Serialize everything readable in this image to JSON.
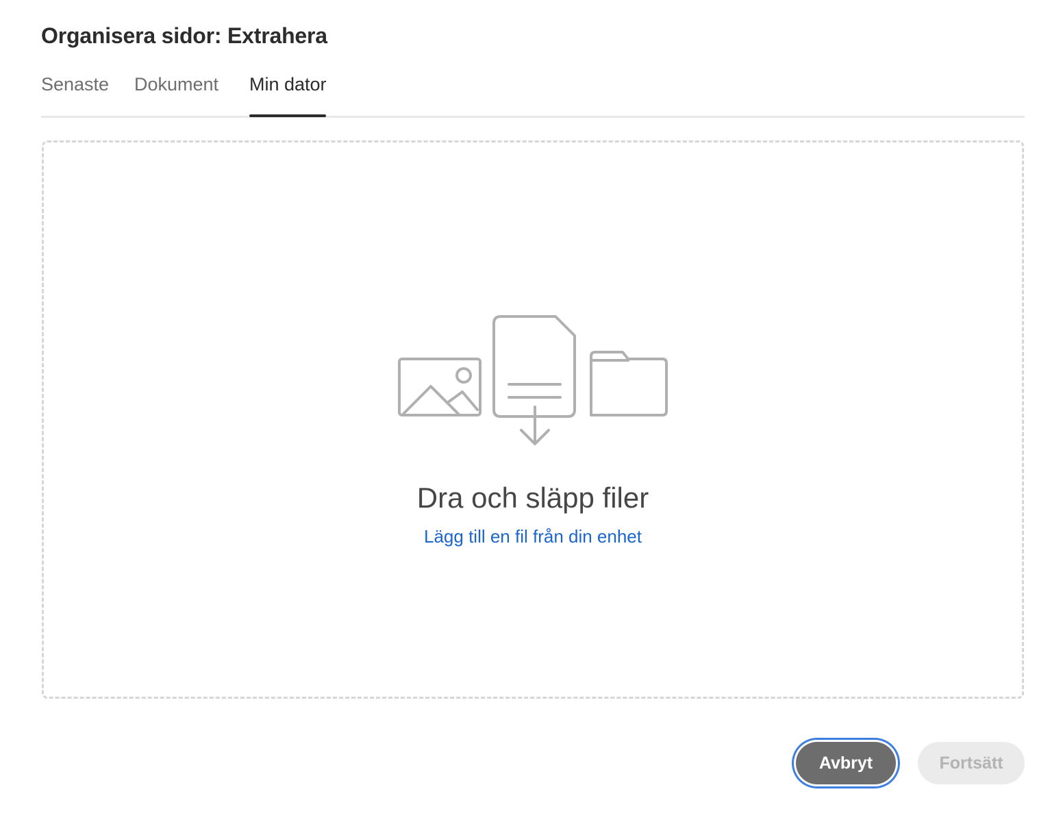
{
  "dialog": {
    "title": "Organisera sidor: Extrahera"
  },
  "tabs": [
    {
      "label": "Senaste",
      "selected": false
    },
    {
      "label": "Dokument",
      "selected": false
    },
    {
      "label": "Min dator",
      "selected": true
    }
  ],
  "dropzone": {
    "heading": "Dra och släpp filer",
    "link": "Lägg till en fil från din enhet",
    "icons": [
      "image-icon",
      "document-download-icon",
      "folder-icon"
    ]
  },
  "actions": {
    "cancel_label": "Avbryt",
    "continue_label": "Fortsätt",
    "continue_enabled": false
  },
  "colors": {
    "link": "#1a66cc",
    "focus_ring": "#3d7fe0",
    "cancel_bg": "#6d6d6d",
    "icon_gray": "#b0b0b0"
  }
}
